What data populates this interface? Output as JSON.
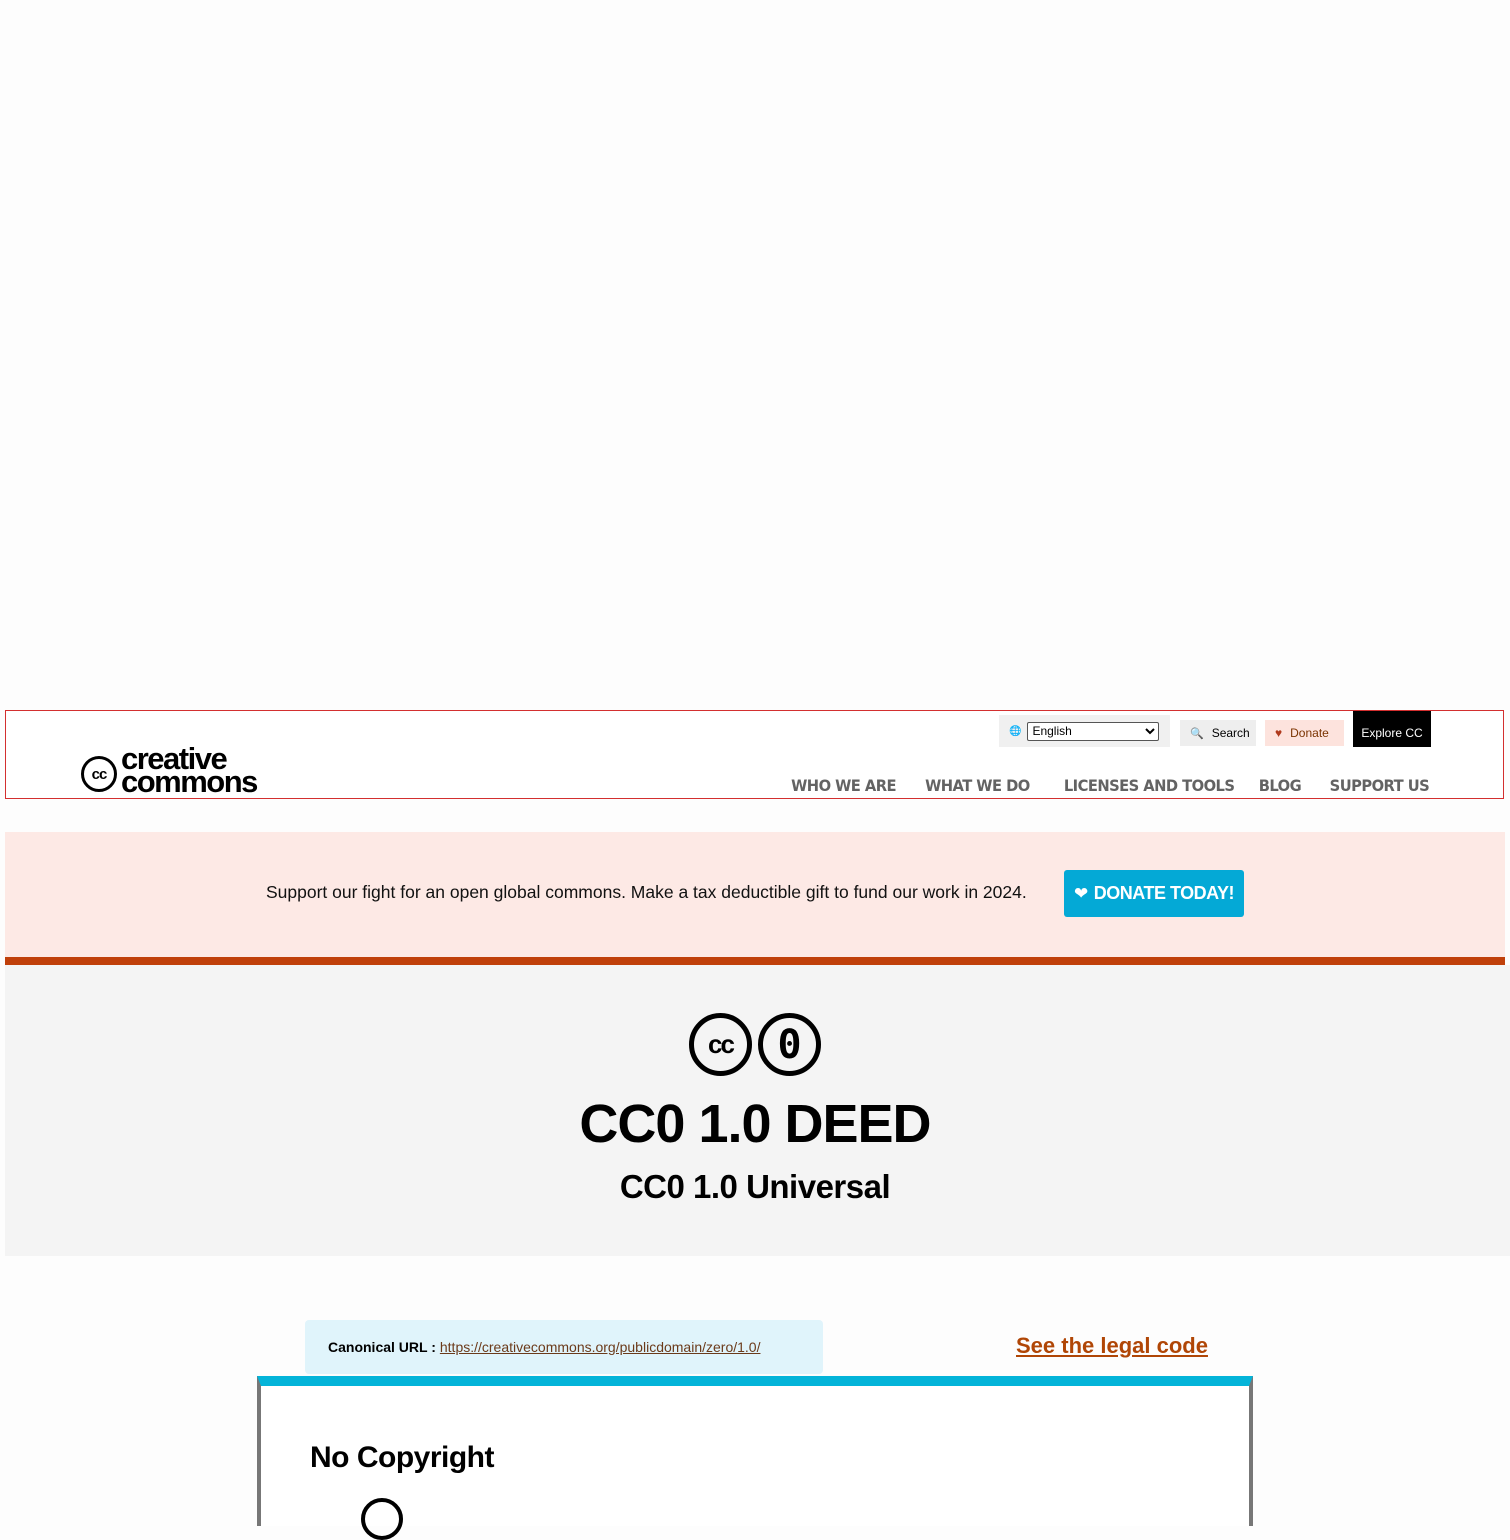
{
  "header": {
    "logo_mark": "cc",
    "logo_line1": "creative",
    "logo_line2": "commons",
    "language": {
      "selected": "English",
      "icon": "globe-icon"
    },
    "search_label": "Search",
    "donate_label": "Donate",
    "explore_label": "Explore CC",
    "nav": [
      "WHO WE ARE",
      "WHAT WE DO",
      "LICENSES AND TOOLS",
      "BLOG",
      "SUPPORT US"
    ]
  },
  "banner": {
    "text": "Support our fight for an open global commons. Make a tax deductible gift to fund our work in 2024.",
    "button_label": "DONATE TODAY!"
  },
  "deed": {
    "badge_cc": "cc",
    "badge_zero": "0",
    "title": "CC0 1.0 DEED",
    "subtitle": "CC0 1.0 Universal"
  },
  "canonical": {
    "label": "Canonical URL :",
    "url": "https://creativecommons.org/publicdomain/zero/1.0/"
  },
  "legal_link": "See the legal code",
  "card": {
    "title": "No Copyright"
  },
  "colors": {
    "banner_bg": "#fde9e5",
    "donate_today_bg": "#04a9d6",
    "banner_rule": "#c0400a",
    "legal_link": "#b04606",
    "card_accent": "#04b4d9"
  }
}
